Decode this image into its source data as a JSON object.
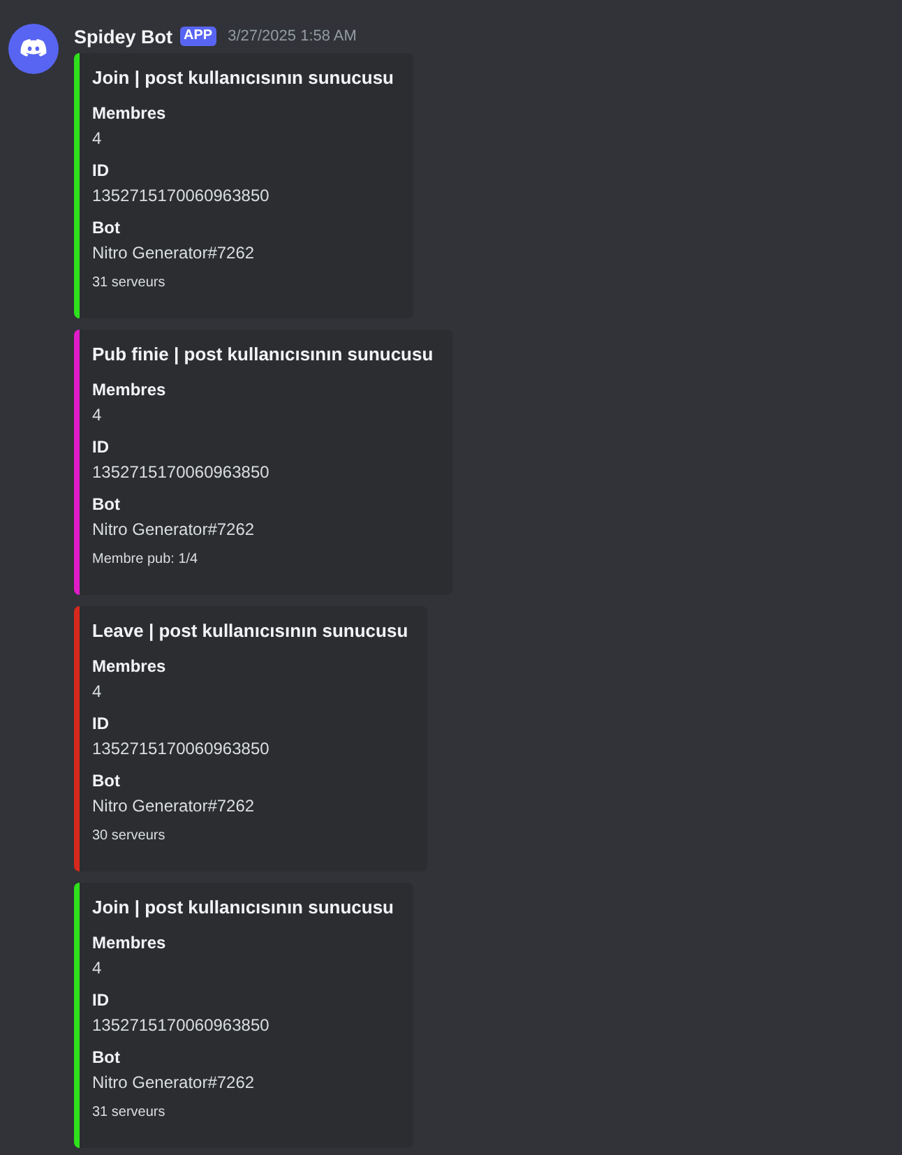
{
  "message": {
    "author": "Spidey Bot",
    "badge": "APP",
    "timestamp": "3/27/2025 1:58 AM",
    "embeds": [
      {
        "color": "#2fe01c",
        "title": "Join | post kullanıcısının sunucusu",
        "fields": [
          {
            "name": "Membres",
            "value": "4"
          },
          {
            "name": "ID",
            "value": "1352715170060963850"
          },
          {
            "name": "Bot",
            "value": "Nitro Generator#7262"
          }
        ],
        "footer": "31 serveurs"
      },
      {
        "color": "#e01cc9",
        "title": "Pub finie | post kullanıcısının sunucusu",
        "fields": [
          {
            "name": "Membres",
            "value": "4"
          },
          {
            "name": "ID",
            "value": "1352715170060963850"
          },
          {
            "name": "Bot",
            "value": "Nitro Generator#7262"
          }
        ],
        "footer": "Membre pub: 1/4"
      },
      {
        "color": "#d6281c",
        "title": "Leave | post kullanıcısının sunucusu",
        "fields": [
          {
            "name": "Membres",
            "value": "4"
          },
          {
            "name": "ID",
            "value": "1352715170060963850"
          },
          {
            "name": "Bot",
            "value": "Nitro Generator#7262"
          }
        ],
        "footer": "30 serveurs"
      },
      {
        "color": "#2fe01c",
        "title": "Join | post kullanıcısının sunucusu",
        "fields": [
          {
            "name": "Membres",
            "value": "4"
          },
          {
            "name": "ID",
            "value": "1352715170060963850"
          },
          {
            "name": "Bot",
            "value": "Nitro Generator#7262"
          }
        ],
        "footer": "31 serveurs"
      }
    ]
  }
}
